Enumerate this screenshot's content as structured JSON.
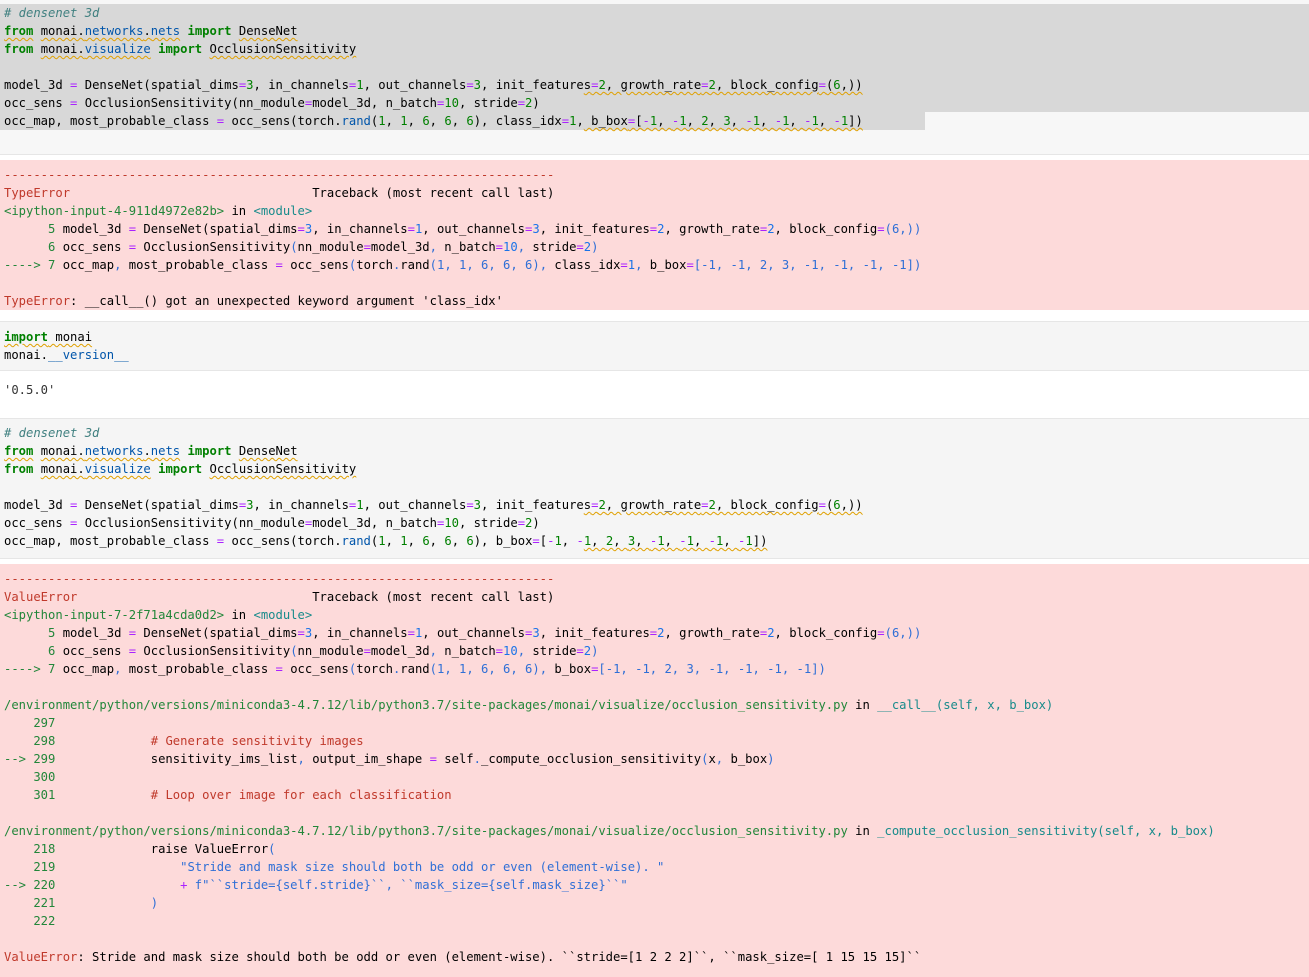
{
  "cell1": {
    "lines": [
      "# densenet 3d",
      "from monai.networks.nets import DenseNet",
      "from monai.visualize import OcclusionSensitivity",
      "",
      "model_3d = DenseNet(spatial_dims=3, in_channels=1, out_channels=3, init_features=2, growth_rate=2, block_config=(6,))",
      "occ_sens = OcclusionSensitivity(nn_module=model_3d, n_batch=10, stride=2)",
      "occ_map, most_probable_class = occ_sens(torch.rand(1, 1, 6, 6, 6), class_idx=1, b_box=[-1, -1, 2, 3, -1, -1, -1, -1])"
    ]
  },
  "error1": {
    "dashes": "---------------------------------------------------------------------------",
    "error_name": "TypeError",
    "traceback_label": "Traceback (most recent call last)",
    "location": "<ipython-input-4-911d4972e82b>",
    "in_word": " in ",
    "module": "<module>",
    "src5": "      5 model_3d = DenseNet(spatial_dims=3, in_channels=1, out_channels=3, init_features=2, growth_rate=2, block_config=(6,))",
    "src6": "      6 occ_sens = OcclusionSensitivity(nn_module=model_3d, n_batch=10, stride=2)",
    "src7": "----> 7 occ_map, most_probable_class = occ_sens(torch.rand(1, 1, 6, 6, 6), class_idx=1, b_box=[-1, -1, 2, 3, -1, -1, -1, -1])",
    "message": ": __call__() got an unexpected keyword argument 'class_idx'"
  },
  "cell2": {
    "lines": [
      "import monai",
      "monai.__version__"
    ]
  },
  "output2": {
    "value": "'0.5.0'"
  },
  "cell3": {
    "lines": [
      "# densenet 3d",
      "from monai.networks.nets import DenseNet",
      "from monai.visualize import OcclusionSensitivity",
      "",
      "model_3d = DenseNet(spatial_dims=3, in_channels=1, out_channels=3, init_features=2, growth_rate=2, block_config=(6,))",
      "occ_sens = OcclusionSensitivity(nn_module=model_3d, n_batch=10, stride=2)",
      "occ_map, most_probable_class = occ_sens(torch.rand(1, 1, 6, 6, 6), b_box=[-1, -1, 2, 3, -1, -1, -1, -1])"
    ]
  },
  "error2": {
    "dashes": "---------------------------------------------------------------------------",
    "error_name": "ValueError",
    "traceback_label": "Traceback (most recent call last)",
    "location": "<ipython-input-7-2f71a4cda0d2>",
    "in_word": " in ",
    "module": "<module>",
    "src5": "      5 model_3d = DenseNet(spatial_dims=3, in_channels=1, out_channels=3, init_features=2, growth_rate=2, block_config=(6,))",
    "src6": "      6 occ_sens = OcclusionSensitivity(nn_module=model_3d, n_batch=10, stride=2)",
    "src7": "----> 7 occ_map, most_probable_class = occ_sens(torch.rand(1, 1, 6, 6, 6), b_box=[-1, -1, 2, 3, -1, -1, -1, -1])",
    "file1": "/environment/python/versions/miniconda3-4.7.12/lib/python3.7/site-packages/monai/visualize/occlusion_sensitivity.py",
    "func1": "__call__(self, x, b_box)",
    "f1_297": "    297",
    "f1_298": "    298             # Generate sensitivity images",
    "f1_299": "--> 299             sensitivity_ims_list, output_im_shape = self._compute_occlusion_sensitivity(x, b_box)",
    "f1_300": "    300",
    "f1_301": "    301             # Loop over image for each classification",
    "file2": "/environment/python/versions/miniconda3-4.7.12/lib/python3.7/site-packages/monai/visualize/occlusion_sensitivity.py",
    "func2": "_compute_occlusion_sensitivity(self, x, b_box)",
    "f2_218": "    218             raise ValueError(",
    "f2_219": "    219                 \"Stride and mask size should both be odd or even (element-wise). \"",
    "f2_220": "--> 220                 + f\"``stride={self.stride}``, ``mask_size={self.mask_size}``\"",
    "f2_221": "    221             )",
    "f2_222": "    222",
    "message": ": Stride and mask size should both be odd or even (element-wise). ``stride=[1 2 2 2]``, ``mask_size=[ 1 15 15 15]``"
  }
}
